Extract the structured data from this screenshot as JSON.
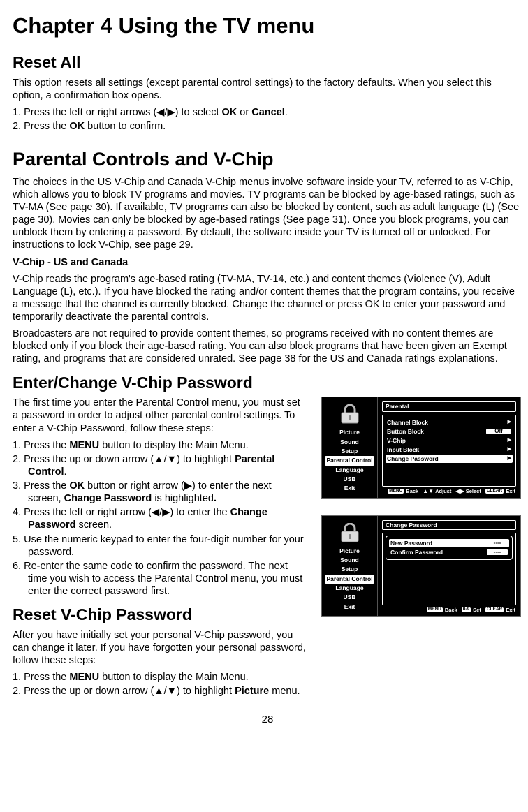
{
  "chapter_title": "Chapter 4 Using the TV menu",
  "page_number": "28",
  "reset_all": {
    "heading": "Reset All",
    "para": "This option resets all settings (except parental control settings) to the factory defaults. When you select this option, a confirmation box opens.",
    "step1_pre": "1. Press the left or right arrows (",
    "step1_post": ") to select ",
    "step1_ok": "OK",
    "step1_or": " or ",
    "step1_cancel": "Cancel",
    "step1_end": ".",
    "step2_pre": "2. Press the ",
    "step2_ok": "OK",
    "step2_post": " button to confirm."
  },
  "parental": {
    "heading": "Parental Controls and V-Chip",
    "para1": "The choices in the US V-Chip and Canada V-Chip menus involve software inside your TV, referred to as V-Chip, which allows you to block TV programs and movies. TV programs can be blocked by age-based ratings, such as TV-MA (See page 30). If available, TV programs can also be blocked by content, such as adult language (L) (See page 30). Movies can only be blocked by age-based ratings (See page 31). Once you block programs, you can unblock them by entering a password. By default, the software inside your TV is turned off or unlocked. For instructions to lock V-Chip, see page 29.",
    "sub1": "V-Chip - US and Canada",
    "para2": "V-Chip reads the program's age-based rating (TV-MA, TV-14, etc.) and content themes (Violence (V), Adult Language (L), etc.). If you have blocked the rating and/or content themes that the program contains, you receive a message that the channel is currently blocked. Change the channel or press OK to enter your password and temporarily deactivate the parental controls.",
    "para3": "Broadcasters are not required to provide content themes, so programs received with no content themes are blocked only if you block their age-based rating. You can also block programs that have been given an Exempt rating, and programs that are considered unrated. See page 38 for the US and Canada ratings explanations."
  },
  "enter": {
    "heading": "Enter/Change V-Chip Password",
    "intro": "The first time you enter the Parental Control menu, you must set a password in order to adjust other parental control settings. To enter a V-Chip Password, follow these steps:",
    "step1_pre": "1.  Press the ",
    "step1_menu": "MENU",
    "step1_post": " button to display the Main Menu.",
    "step2_pre": "2.  Press the up or down arrow (",
    "step2_post": ") to highlight ",
    "step2_pc": "Parental Control",
    "step2_end": ".",
    "step3_pre": "3.  Press the ",
    "step3_ok": "OK",
    "step3_mid": " button or right arrow (",
    "step3_post": ") to enter the next screen, ",
    "step3_cp": "Change Password",
    "step3_end": " is highlighted",
    "step3_dot": ".",
    "step4_pre": "4.  Press the left or right arrow (",
    "step4_post": ") to enter the ",
    "step4_cp": "Change Password",
    "step4_end": " screen.",
    "step5": "5.  Use the numeric keypad to enter the four-digit number for your password.",
    "step6": "6.  Re-enter the same code to confirm the password. The next time you wish to access the Parental Control menu, you must enter the correct password first."
  },
  "resetpw": {
    "heading": "Reset V-Chip Password",
    "intro": "After you have initially set your personal V-Chip password, you can change it later. If you have forgotten your personal password, follow these steps:",
    "step1_pre": "1. Press the ",
    "step1_menu": "MENU",
    "step1_post": " button to display the Main Menu.",
    "step2_pre": "2. Press the up or down arrow (",
    "step2_post": ") to highlight ",
    "step2_pic": "Picture",
    "step2_end": " menu."
  },
  "osd": {
    "menu": {
      "picture": "Picture",
      "sound": "Sound",
      "setup": "Setup",
      "parental_control": "Parental Control",
      "language": "Language",
      "usb": "USB",
      "exit": "Exit"
    },
    "panel1": {
      "title": "Parental",
      "channel_block": "Channel Block",
      "button_block": "Button Block",
      "off": "Off",
      "vchip": "V-Chip",
      "input_block": "Input Block",
      "change_password": "Change Password"
    },
    "panel2": {
      "title": "Change Password",
      "new_password": "New Password",
      "confirm_password": "Confirm Password",
      "dashes": "----"
    },
    "hints": {
      "back": "Back",
      "adjust": "Adjust",
      "select": "Select",
      "exit": "Exit",
      "set": "Set",
      "menu_btn": "MENU",
      "clear_btn": "CLEAR",
      "num_btn": "0-9"
    }
  }
}
